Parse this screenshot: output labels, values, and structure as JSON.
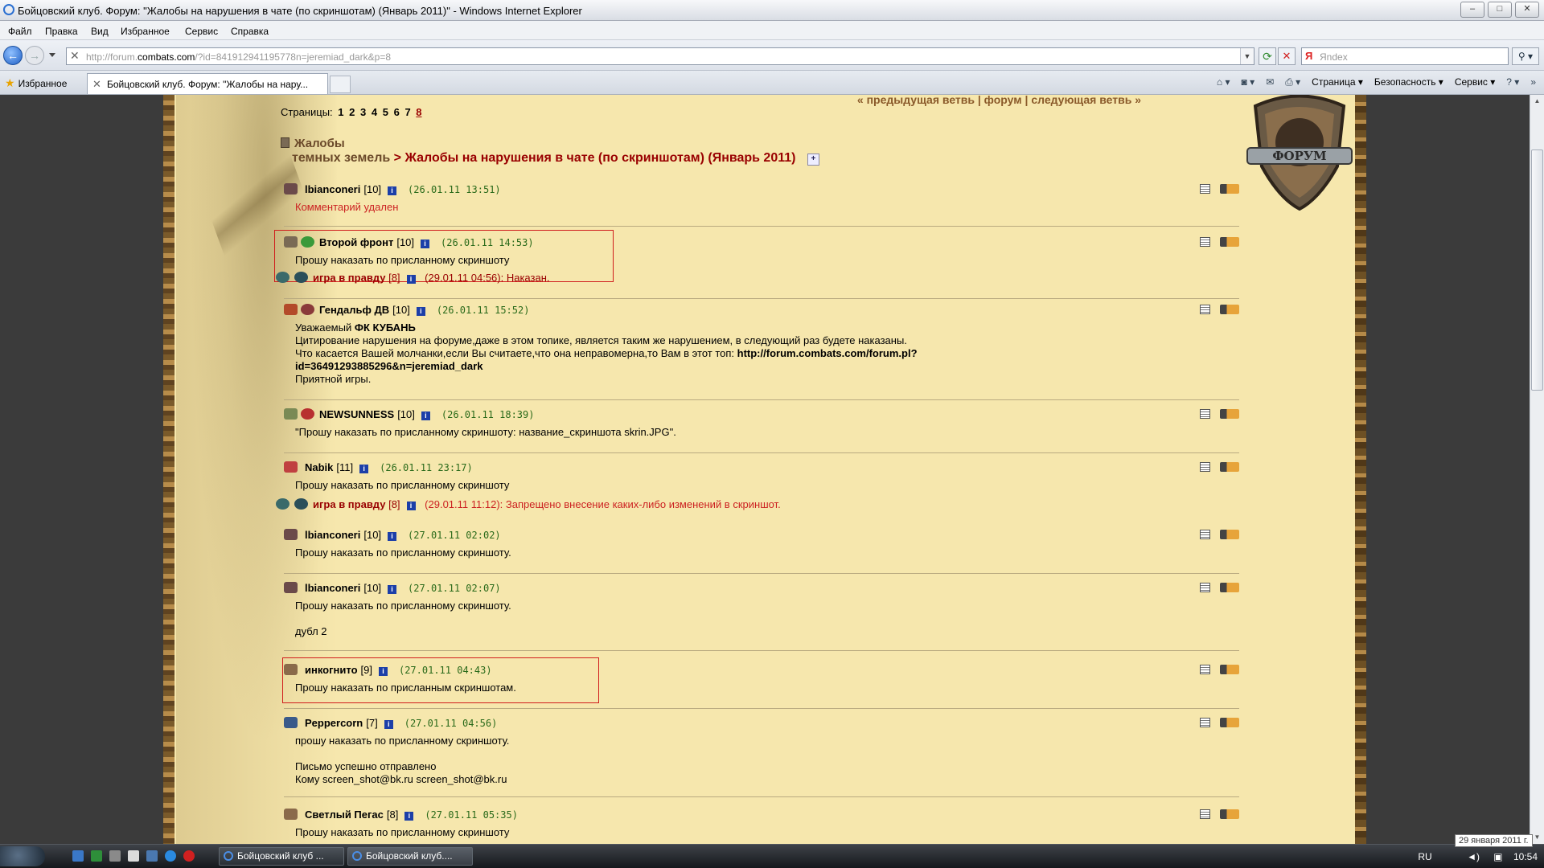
{
  "window": {
    "title": "Бойцовский клуб. Форум: \"Жалобы на нарушения в чате (по скриншотам) (Январь 2011)\" - Windows Internet Explorer"
  },
  "menu": [
    "Файл",
    "Правка",
    "Вид",
    "Избранное",
    "Сервис",
    "Справка"
  ],
  "address": {
    "prefix": "http://forum.",
    "domain": "combats.com",
    "suffix": "/?id=841912941195778n=jeremiad_dark&p=8",
    "search_placeholder": "Яndex"
  },
  "favorites_label": "Избранное",
  "tab_title": "Бойцовский клуб. Форум: \"Жалобы на нару...",
  "command_bar": {
    "page": "Страница",
    "security": "Безопасность",
    "tools": "Сервис"
  },
  "forum": {
    "topnav": "« предыдущая ветвь | форум | следующая ветвь »",
    "pages_label": "Страницы:",
    "pages": [
      "1",
      "2",
      "3",
      "4",
      "5",
      "6",
      "7",
      "8"
    ],
    "current_page": "8",
    "crumb1": "Жалобы",
    "crumb2_part1": "темных земель",
    "crumb2_part2": "> Жалобы на нарушения в чате (по скриншотам) (Январь 2011)"
  },
  "posts": [
    {
      "nick": "lbianconeri",
      "level": "[10]",
      "date": "(26.01.11 13:51)",
      "lines": [
        "Комментарий удален"
      ],
      "deleted": true
    },
    {
      "nick": "Второй фронт",
      "level": "[10]",
      "date": "(26.01.11 14:53)",
      "lines": [
        "Прошу наказать по присланному скриншоту"
      ],
      "mod": {
        "nick": "игра в правду",
        "level": "[8]",
        "text": "(29.01.11 04:56): Наказан."
      }
    },
    {
      "nick": "Гендальф ДВ",
      "level": "[10]",
      "date": "(26.01.11 15:52)",
      "lines": [
        "Уважаемый ",
        "Цитирование нарушения на форуме,даже в этом топике, является таким же нарушением, в следующий раз будете наказаны.",
        "Что касается Вашей молчанки,если Вы считаете,что она неправомерна,то Вам в этот топ: ",
        "id=36491293885296&n=jeremiad_dark",
        "Приятной игры."
      ],
      "bold": "ФК КУБАНЬ",
      "link": "http://forum.combats.com/forum.pl?"
    },
    {
      "nick": "NEWSUNNESS",
      "level": "[10]",
      "date": "(26.01.11 18:39)",
      "lines": [
        "\"Прошу наказать по присланному скриншоту: название_скриншота skrin.JPG\"."
      ]
    },
    {
      "nick": "Nabik",
      "level": "[11]",
      "date": "(26.01.11 23:17)",
      "lines": [
        "Прошу наказать по присланному скриншоту"
      ],
      "mod": {
        "nick": "игра в правду",
        "level": "[8]",
        "text": "(29.01.11 11:12): Запрещено внесение каких-либо изменений в скриншот."
      }
    },
    {
      "nick": "lbianconeri",
      "level": "[10]",
      "date": "(27.01.11 02:02)",
      "lines": [
        "Прошу наказать по присланному скриншоту."
      ]
    },
    {
      "nick": "lbianconeri",
      "level": "[10]",
      "date": "(27.01.11 02:07)",
      "lines": [
        "Прошу наказать по присланному скриншоту.",
        "дубл 2"
      ]
    },
    {
      "nick": "инкогнито",
      "level": "[9]",
      "date": "(27.01.11 04:43)",
      "lines": [
        "Прошу наказать по присланным скриншотам."
      ]
    },
    {
      "nick": "Peppercorn",
      "level": "[7]",
      "date": "(27.01.11 04:56)",
      "lines": [
        "прошу наказать по присланному скриншоту.",
        "Письмо успешно отправлено",
        "Кому screen_shot@bk.ru screen_shot@bk.ru"
      ]
    },
    {
      "nick": "Светлый Пегас",
      "level": "[8]",
      "date": "(27.01.11 05:35)",
      "lines": [
        "Прошу наказать по присланному скриншоту"
      ]
    }
  ],
  "info_icon": "i",
  "taskbar": {
    "btn1": "Бойцовский клуб ...",
    "btn2": "Бойцовский клуб....",
    "lang": "RU",
    "time": "10:54",
    "date_tooltip": "29 января 2011 г."
  },
  "colors": {
    "parchment": "#f6e7ad",
    "accent": "#990000",
    "date_green": "#2a6a1a",
    "highlight_box": "#d01c1c"
  },
  "icons": [
    "ie-icon",
    "back-icon",
    "forward-icon",
    "refresh-icon",
    "stop-icon",
    "search-icon",
    "star-icon",
    "note-icon",
    "key-icon",
    "info-icon",
    "forum-shield-logo"
  ]
}
